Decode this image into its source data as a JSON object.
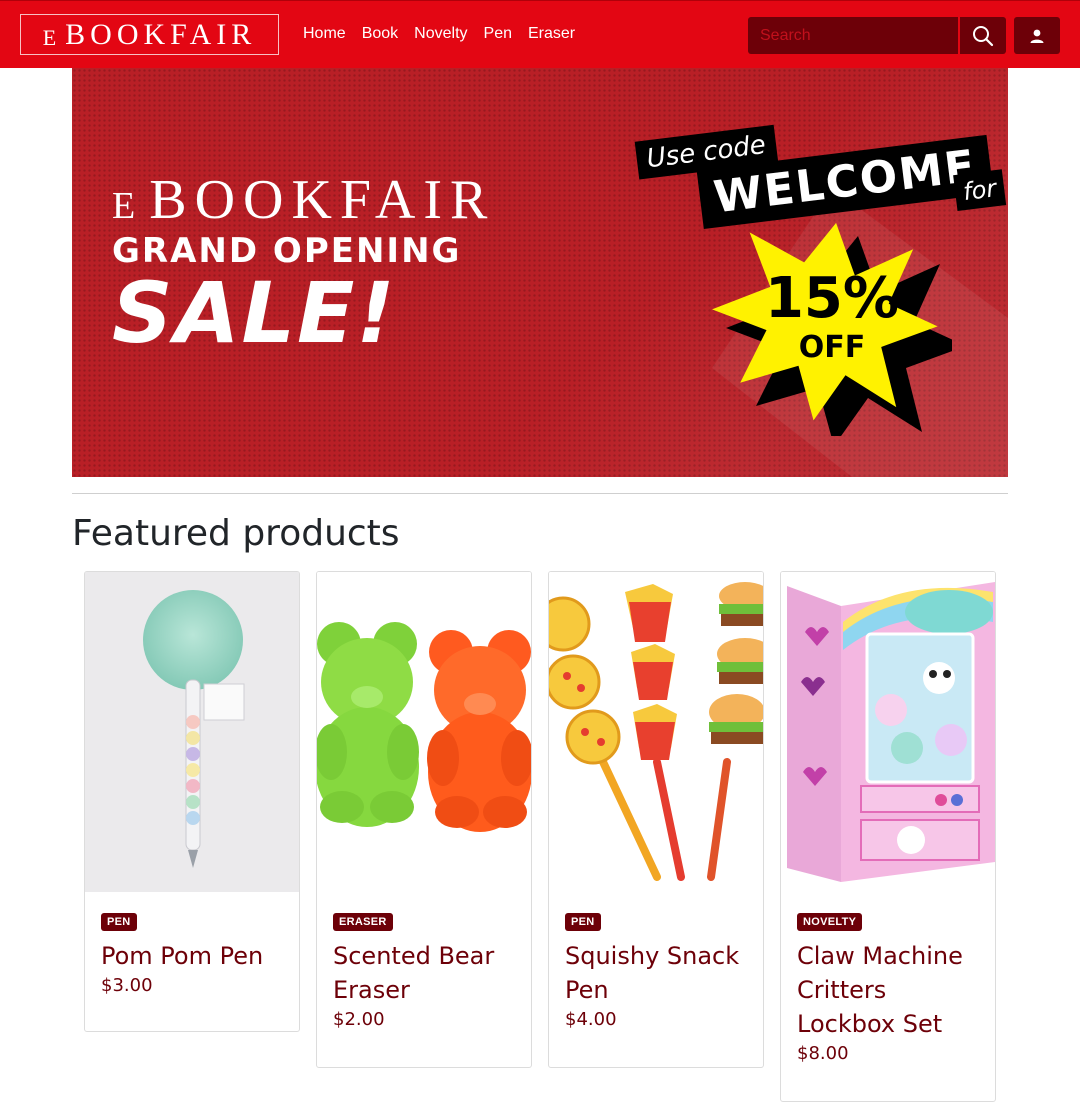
{
  "header": {
    "brand_small": "E",
    "brand_big": "BOOKFAIR",
    "nav": [
      "Home",
      "Book",
      "Novelty",
      "Pen",
      "Eraser"
    ],
    "search_placeholder": "Search"
  },
  "banner": {
    "brand_small": "E",
    "brand_big": "BOOKFAIR",
    "subtitle": "GRAND OPENING",
    "headline": "SALE!",
    "use_code": "Use code",
    "code": "WELCOME",
    "for": "for",
    "discount": "15%",
    "off": "OFF"
  },
  "section": {
    "title": "Featured products"
  },
  "products": [
    {
      "category": "PEN",
      "name": "Pom Pom Pen",
      "price": "$3.00"
    },
    {
      "category": "ERASER",
      "name": "Scented Bear Eraser",
      "price": "$2.00"
    },
    {
      "category": "PEN",
      "name": "Squishy Snack Pen",
      "price": "$4.00"
    },
    {
      "category": "NOVELTY",
      "name": "Claw Machine Critters Lockbox Set",
      "price": "$8.00"
    }
  ],
  "colors": {
    "primary": "#e30613",
    "dark": "#6d0008",
    "banner": "#b91f26",
    "burst": "#fff200"
  }
}
